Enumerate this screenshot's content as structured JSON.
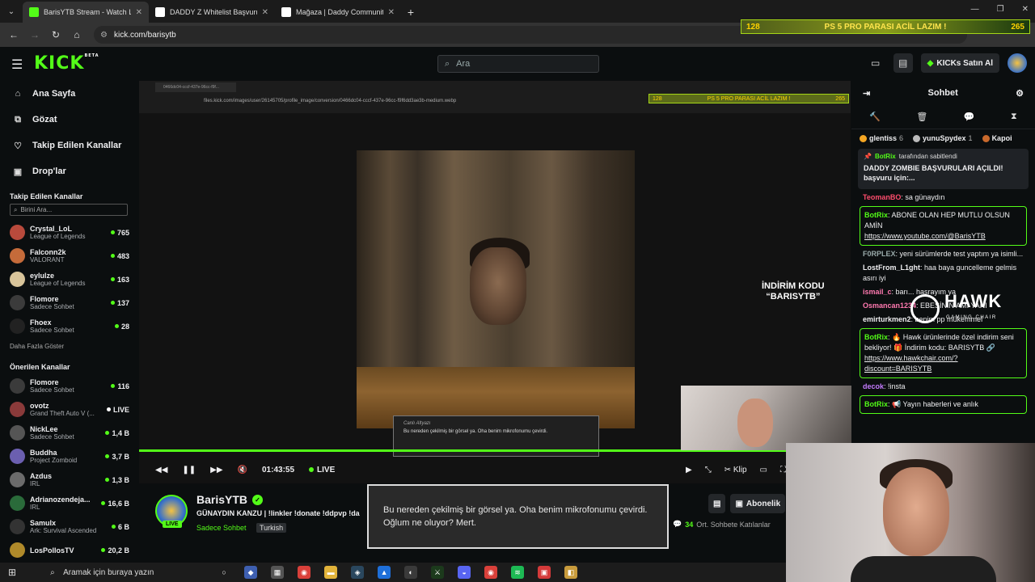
{
  "browser": {
    "tabs": [
      {
        "title": "BarisYTB Stream - Watch Live o",
        "active": true,
        "color": "#53fc18"
      },
      {
        "title": "DADDY Z Whitelist Başvurusu |",
        "active": false,
        "color": "#ffffff"
      },
      {
        "title": "Mağaza | Daddy Community",
        "active": false,
        "color": "#ffffff"
      }
    ],
    "url": "kick.com/barisytb"
  },
  "overlay_banner": {
    "left": "128",
    "text": "PS 5 PRO PARASI ACİL LAZIM !",
    "right": "265"
  },
  "header": {
    "logo": "KICK",
    "logo_badge": "BETA",
    "search_placeholder": "Ara",
    "kicks_label": "KICKs Satın Al"
  },
  "sidebar": {
    "nav": [
      {
        "label": "Ana Sayfa",
        "icon": "home-icon",
        "glyph": "⌂"
      },
      {
        "label": "Gözat",
        "icon": "browse-icon",
        "glyph": "⧉"
      },
      {
        "label": "Takip Edilen Kanallar",
        "icon": "heart-icon",
        "glyph": "♡"
      },
      {
        "label": "Drop'lar",
        "icon": "gift-icon",
        "glyph": "▣"
      }
    ],
    "following_title": "Takip Edilen Kanallar",
    "search_placeholder": "Birini Ara...",
    "following": [
      {
        "name": "Crystal_LoL",
        "category": "League of Legends",
        "viewers": "765",
        "color": "#b84a3c"
      },
      {
        "name": "Falconn2k",
        "category": "VALORANT",
        "viewers": "483",
        "color": "#c56b3a"
      },
      {
        "name": "eylulze",
        "category": "League of Legends",
        "viewers": "163",
        "color": "#d8c49a"
      },
      {
        "name": "Flomore",
        "category": "Sadece Sohbet",
        "viewers": "137",
        "color": "#3b3b3b"
      },
      {
        "name": "Fhoex",
        "category": "Sadece Sohbet",
        "viewers": "28",
        "color": "#222222"
      }
    ],
    "show_more": "Daha Fazla Göster",
    "recommended_title": "Önerilen Kanallar",
    "recommended": [
      {
        "name": "Flomore",
        "category": "Sadece Sohbet",
        "viewers": "116",
        "color": "#3b3b3b"
      },
      {
        "name": "ovotz",
        "category": "Grand Theft Auto V (...",
        "viewers": "LIVE",
        "color": "#8a3a3a"
      },
      {
        "name": "NickLee",
        "category": "Sadece Sohbet",
        "viewers": "1,4 B",
        "color": "#555555"
      },
      {
        "name": "Buddha",
        "category": "Project Zomboid",
        "viewers": "3,7 B",
        "color": "#6b5fb0"
      },
      {
        "name": "Azdus",
        "category": "IRL",
        "viewers": "1,3 B",
        "color": "#6b6b6b"
      },
      {
        "name": "Adrianozendeja...",
        "category": "IRL",
        "viewers": "16,6 B",
        "color": "#2a6b3a"
      },
      {
        "name": "Samulx",
        "category": "Ark: Survival Ascended",
        "viewers": "6 B",
        "color": "#333333"
      },
      {
        "name": "LosPollosTV",
        "category": "",
        "viewers": "20,2 B",
        "color": "#b08a2a"
      }
    ]
  },
  "player": {
    "inner_url": "files.kick.com/images/user/26145705/profile_image/conversion/0466dc04-cccf-437e-96cc-f9f6dd3ae3b-medium.webp",
    "promo_line1": "İNDİRİM KODU",
    "promo_line2": "“BARISYTB”",
    "caption_label": "Canlı Altyazı",
    "caption_text": "Bu nereden çekilmiş bir görsel ya. Oha benim mikrofonumu çevirdi.",
    "time": "01:43:55",
    "live_label": "LIVE",
    "clip_label": "Klip",
    "progress": 1.0
  },
  "stream": {
    "name": "BarisYTB",
    "live_badge": "LIVE",
    "title": "GÜNAYDIN KANZU | !linkler !donate !ddpvp !da",
    "category": "Sadece Sohbet",
    "language": "Turkish",
    "subscribe_label": "Abonelik",
    "viewer_count": "34",
    "viewer_label": "Ort. Sohbete Katılanlar"
  },
  "caption_overlay": "Bu nereden çekilmiş bir görsel ya. Oha benim mikrofonumu çevirdi. Oğlum ne oluyor? Mert.",
  "chat": {
    "title": "Sohbet",
    "gifters": [
      {
        "name": "glentiss",
        "count": "6",
        "color": "#f5a623"
      },
      {
        "name": "yunuSpydex",
        "count": "1",
        "color": "#bbbbbb"
      },
      {
        "name": "Kapoi",
        "count": "",
        "color": "#c9692c"
      }
    ],
    "pinned_by": "BotRix",
    "pinned_suffix": "tarafından sabitlendi",
    "pinned_text": "DADDY ZOMBIE BAŞVURULARI AÇILDI! başvuru için:...",
    "messages": [
      {
        "user": "TeomanBO",
        "text": ": sa günaydın",
        "color": "#ff4d6d",
        "kind": "plain"
      },
      {
        "user": "BotRix",
        "text": ": ABONE OLAN HEP MUTLU OLSUN AMİN",
        "link": "https://www.youtube.com/@BarisYTB",
        "kind": "bot"
      },
      {
        "user": "F0RPLEX",
        "text": ": yeni sürümlerde test yaptım ya isimli...",
        "color": "#9aa",
        "kind": "plain"
      },
      {
        "user": "LostFrom_L1ght",
        "text": ": haa baya guncelleme gelmis asırı iyi",
        "color": "#efeff1",
        "kind": "plain"
      },
      {
        "user": "ismail_c",
        "text": ": barı... hasrayım ya",
        "color": "#ff79b0",
        "kind": "plain"
      },
      {
        "user": "Osmancan1234",
        "text": ": EBESİNİN AMI YANI",
        "color": "#ff79b0",
        "kind": "plain"
      },
      {
        "user": "emirturkmen2",
        "text": ": benim pp mükemmel",
        "color": "#efeff1",
        "kind": "plain"
      },
      {
        "user": "BotRix",
        "text": ": 🔥 Hawk ürünlerinde özel indirim seni bekliyor! 🎁 İndirim kodu: BARISYTB 🔗",
        "link": "https://www.hawkchair.com/?discount=BARISYTB",
        "kind": "bot"
      },
      {
        "user": "decok",
        "text": ": !insta",
        "color": "#c57bff",
        "kind": "plain"
      },
      {
        "user": "BotRix",
        "text": ": 📢 Yayın haberleri ve anlık",
        "link": "",
        "kind": "bot"
      }
    ]
  },
  "hawk": {
    "brand": "HAWK",
    "sub": "GAMING CHAIR"
  },
  "taskbar": {
    "search_placeholder": "Aramak için buraya yazın",
    "apps": [
      {
        "icon": "task-view-icon",
        "color": "#1c1c1c",
        "glyph": "○"
      },
      {
        "icon": "app-icon",
        "color": "#3e5fb0",
        "glyph": "◆"
      },
      {
        "icon": "calculator-icon",
        "color": "#555555",
        "glyph": "▦"
      },
      {
        "icon": "chrome-icon",
        "color": "#d9403a",
        "glyph": "◉"
      },
      {
        "icon": "folder-icon",
        "color": "#e2b33a",
        "glyph": "▬"
      },
      {
        "icon": "steam-icon",
        "color": "#2a475e",
        "glyph": "◈"
      },
      {
        "icon": "app-icon",
        "color": "#1e6fd9",
        "glyph": "▲"
      },
      {
        "icon": "obs-icon",
        "color": "#3a3a3a",
        "glyph": "◐"
      },
      {
        "icon": "app-icon",
        "color": "#1c3a1c",
        "glyph": "⚔"
      },
      {
        "icon": "discord-icon",
        "color": "#5865f2",
        "glyph": "◒"
      },
      {
        "icon": "chrome-icon",
        "color": "#d9403a",
        "glyph": "◉"
      },
      {
        "icon": "spotify-icon",
        "color": "#1db954",
        "glyph": "≋"
      },
      {
        "icon": "app-icon",
        "color": "#d43a3a",
        "glyph": "▣"
      },
      {
        "icon": "app-icon",
        "color": "#c89b3c",
        "glyph": "◧"
      }
    ]
  }
}
